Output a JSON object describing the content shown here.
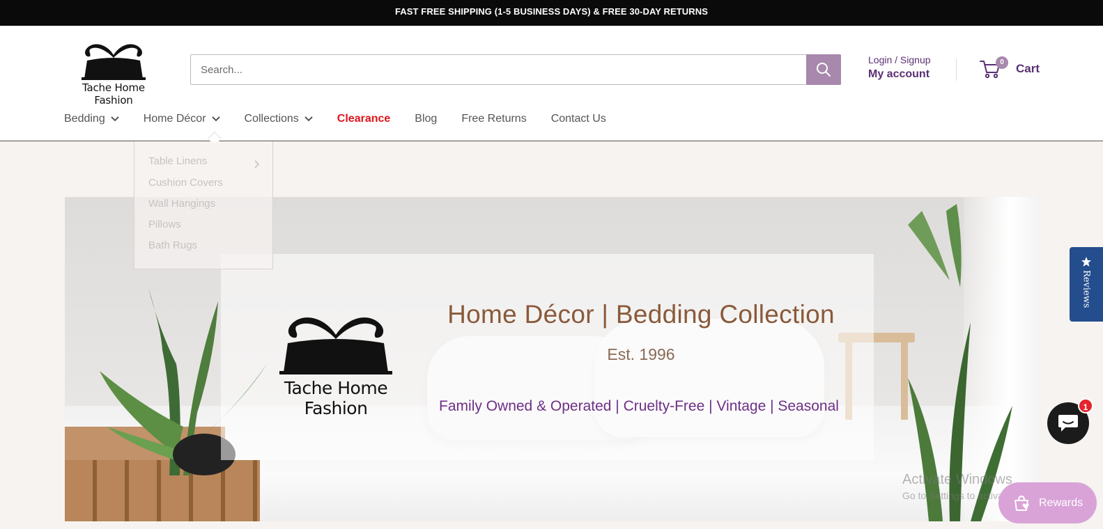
{
  "announcement": "FAST FREE SHIPPING (1-5 BUSINESS DAYS) & FREE 30-DAY RETURNS",
  "brand": {
    "name": "Tache Home Fashion"
  },
  "search": {
    "placeholder": "Search..."
  },
  "account": {
    "login_label": "Login / Signup",
    "account_label": "My account"
  },
  "cart": {
    "count": "0",
    "label": "Cart"
  },
  "nav": {
    "items": [
      {
        "label": "Bedding",
        "has_dropdown": true
      },
      {
        "label": "Home Décor",
        "has_dropdown": true
      },
      {
        "label": "Collections",
        "has_dropdown": true
      },
      {
        "label": "Clearance",
        "has_dropdown": false
      },
      {
        "label": "Blog",
        "has_dropdown": false
      },
      {
        "label": "Free Returns",
        "has_dropdown": false
      },
      {
        "label": "Contact Us",
        "has_dropdown": false
      }
    ]
  },
  "dropdown": {
    "items": [
      {
        "label": "Table Linens"
      },
      {
        "label": "Cushion Covers"
      },
      {
        "label": "Wall Hangings"
      },
      {
        "label": "Pillows"
      },
      {
        "label": "Bath Rugs"
      }
    ]
  },
  "hero": {
    "title": "Home Décor | Bedding Collection",
    "established": "Est. 1996",
    "tags": "Family Owned & Operated | Cruelty-Free | Vintage | Seasonal"
  },
  "reviews_tab": {
    "label": "Reviews"
  },
  "chat": {
    "badge": "1"
  },
  "watermark": {
    "line1": "Activate Windows",
    "line2": "Go to Settings to activate Windows."
  },
  "rewards": {
    "label": "Rewards"
  },
  "colors": {
    "accent_purple": "#5a2f74",
    "search_button": "#a888ac",
    "clearance_red": "#e0151c",
    "reviews_blue": "#234d8c",
    "rewards_pink": "#d9a3d8"
  }
}
